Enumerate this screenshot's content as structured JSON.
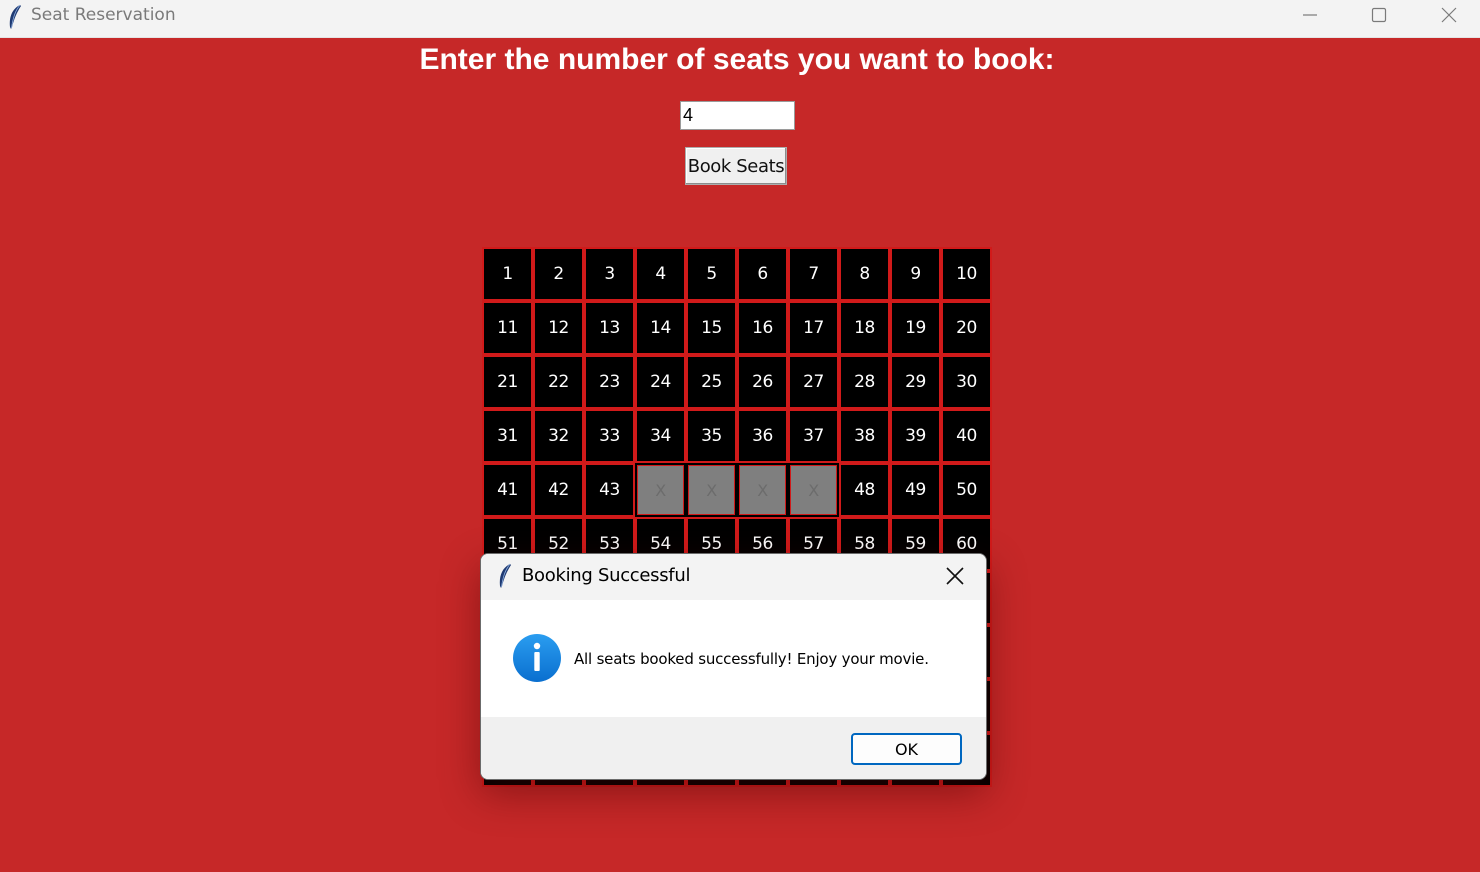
{
  "window": {
    "title": "Seat Reservation",
    "icon": "feather-icon"
  },
  "main": {
    "heading": "Enter the number of seats you want to book:",
    "seat_count_value": "4",
    "book_button_label": "Book Seats"
  },
  "seats": [
    {
      "label": "1"
    },
    {
      "label": "2"
    },
    {
      "label": "3"
    },
    {
      "label": "4"
    },
    {
      "label": "5"
    },
    {
      "label": "6"
    },
    {
      "label": "7"
    },
    {
      "label": "8"
    },
    {
      "label": "9"
    },
    {
      "label": "10"
    },
    {
      "label": "11"
    },
    {
      "label": "12"
    },
    {
      "label": "13"
    },
    {
      "label": "14"
    },
    {
      "label": "15"
    },
    {
      "label": "16"
    },
    {
      "label": "17"
    },
    {
      "label": "18"
    },
    {
      "label": "19"
    },
    {
      "label": "20"
    },
    {
      "label": "21"
    },
    {
      "label": "22"
    },
    {
      "label": "23"
    },
    {
      "label": "24"
    },
    {
      "label": "25"
    },
    {
      "label": "26"
    },
    {
      "label": "27"
    },
    {
      "label": "28"
    },
    {
      "label": "29"
    },
    {
      "label": "30"
    },
    {
      "label": "31"
    },
    {
      "label": "32"
    },
    {
      "label": "33"
    },
    {
      "label": "34"
    },
    {
      "label": "35"
    },
    {
      "label": "36"
    },
    {
      "label": "37"
    },
    {
      "label": "38"
    },
    {
      "label": "39"
    },
    {
      "label": "40"
    },
    {
      "label": "41"
    },
    {
      "label": "42"
    },
    {
      "label": "43"
    },
    {
      "label": "X",
      "booked": true
    },
    {
      "label": "X",
      "booked": true
    },
    {
      "label": "X",
      "booked": true
    },
    {
      "label": "X",
      "booked": true
    },
    {
      "label": "48"
    },
    {
      "label": "49"
    },
    {
      "label": "50"
    },
    {
      "label": "51"
    },
    {
      "label": "52"
    },
    {
      "label": "53"
    },
    {
      "label": "54"
    },
    {
      "label": "55"
    },
    {
      "label": "56"
    },
    {
      "label": "57"
    },
    {
      "label": "58"
    },
    {
      "label": "59"
    },
    {
      "label": "60"
    },
    {
      "label": ""
    },
    {
      "label": ""
    },
    {
      "label": ""
    },
    {
      "label": ""
    },
    {
      "label": ""
    },
    {
      "label": ""
    },
    {
      "label": ""
    },
    {
      "label": ""
    },
    {
      "label": ""
    },
    {
      "label": ""
    },
    {
      "label": ""
    },
    {
      "label": ""
    },
    {
      "label": ""
    },
    {
      "label": ""
    },
    {
      "label": ""
    },
    {
      "label": ""
    },
    {
      "label": ""
    },
    {
      "label": ""
    },
    {
      "label": ""
    },
    {
      "label": ""
    },
    {
      "label": ""
    },
    {
      "label": ""
    },
    {
      "label": ""
    },
    {
      "label": ""
    },
    {
      "label": ""
    },
    {
      "label": ""
    },
    {
      "label": ""
    },
    {
      "label": ""
    },
    {
      "label": ""
    },
    {
      "label": ""
    },
    {
      "label": ""
    },
    {
      "label": ""
    },
    {
      "label": ""
    },
    {
      "label": ""
    },
    {
      "label": ""
    },
    {
      "label": ""
    },
    {
      "label": ""
    },
    {
      "label": ""
    },
    {
      "label": ""
    },
    {
      "label": ""
    }
  ],
  "dialog": {
    "title": "Booking Successful",
    "icon": "info-icon",
    "message": "All seats booked successfully! Enjoy your movie.",
    "ok_label": "OK"
  },
  "colors": {
    "background": "#c62828",
    "seat_available": "#000000",
    "seat_booked": "#7f7f7f",
    "seat_border": "#d11a1a",
    "accent": "#0067c0"
  }
}
